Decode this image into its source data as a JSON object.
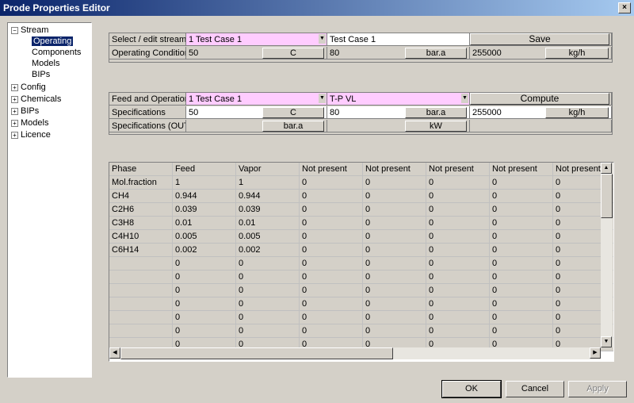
{
  "window": {
    "title": "Prode Properties Editor",
    "close_label": "×"
  },
  "tree": [
    {
      "label": "Stream",
      "expander": "−",
      "level": 0
    },
    {
      "label": "Operating",
      "level": 2,
      "selected": true
    },
    {
      "label": "Components",
      "level": 2
    },
    {
      "label": "Models",
      "level": 2
    },
    {
      "label": "BIPs",
      "level": 2
    },
    {
      "label": "Config",
      "expander": "+",
      "level": 0
    },
    {
      "label": "Chemicals",
      "expander": "+",
      "level": 0
    },
    {
      "label": "BIPs",
      "expander": "+",
      "level": 0
    },
    {
      "label": "Models",
      "expander": "+",
      "level": 0
    },
    {
      "label": "Licence",
      "expander": "+",
      "level": 0
    }
  ],
  "stream_panel": {
    "select_label": "Select / edit stream",
    "stream_select": "1  Test Case 1",
    "stream_name": "Test Case 1",
    "save_label": "Save",
    "op_cond_label": "Operating Conditions",
    "temp_value": "50",
    "temp_unit": "C",
    "press_value": "80",
    "press_unit": "bar.a",
    "flow_value": "255000",
    "flow_unit": "kg/h"
  },
  "feed_panel": {
    "feed_label": "Feed and Operation",
    "feed_select": "1  Test Case 1",
    "operation_select": "T-P VL",
    "compute_label": "Compute",
    "spec_label": "Specifications",
    "spec_temp": "50",
    "spec_temp_unit": "C",
    "spec_press": "80",
    "spec_press_unit": "bar.a",
    "spec_flow": "255000",
    "spec_flow_unit": "kg/h",
    "spec_out_label": "Specifications (OUT)",
    "out_unit1": "bar.a",
    "out_unit2": "kW"
  },
  "results_table": {
    "headers": [
      "Phase",
      "Feed",
      "Vapor",
      "Not present",
      "Not present",
      "Not present",
      "Not present",
      "Not present"
    ],
    "rows": [
      [
        "Mol.fraction",
        "1",
        "1",
        "0",
        "0",
        "0",
        "0",
        "0"
      ],
      [
        "CH4",
        "0.944",
        "0.944",
        "0",
        "0",
        "0",
        "0",
        "0"
      ],
      [
        "C2H6",
        "0.039",
        "0.039",
        "0",
        "0",
        "0",
        "0",
        "0"
      ],
      [
        "C3H8",
        "0.01",
        "0.01",
        "0",
        "0",
        "0",
        "0",
        "0"
      ],
      [
        "C4H10",
        "0.005",
        "0.005",
        "0",
        "0",
        "0",
        "0",
        "0"
      ],
      [
        "C6H14",
        "0.002",
        "0.002",
        "0",
        "0",
        "0",
        "0",
        "0"
      ],
      [
        "",
        "0",
        "0",
        "0",
        "0",
        "0",
        "0",
        "0"
      ],
      [
        "",
        "0",
        "0",
        "0",
        "0",
        "0",
        "0",
        "0"
      ],
      [
        "",
        "0",
        "0",
        "0",
        "0",
        "0",
        "0",
        "0"
      ],
      [
        "",
        "0",
        "0",
        "0",
        "0",
        "0",
        "0",
        "0"
      ],
      [
        "",
        "0",
        "0",
        "0",
        "0",
        "0",
        "0",
        "0"
      ],
      [
        "",
        "0",
        "0",
        "0",
        "0",
        "0",
        "0",
        "0"
      ],
      [
        "",
        "0",
        "0",
        "0",
        "0",
        "0",
        "0",
        "0"
      ]
    ]
  },
  "dialog_buttons": {
    "ok": "OK",
    "cancel": "Cancel",
    "apply": "Apply"
  },
  "colors": {
    "title_start": "#0a246a",
    "title_end": "#a6caf0",
    "highlight": "#ffccff",
    "face": "#d4d0c8"
  },
  "icons": {
    "close": "close-icon",
    "dropdown": "chevron-down-icon",
    "expand": "plus-box-icon",
    "collapse": "minus-box-icon"
  }
}
